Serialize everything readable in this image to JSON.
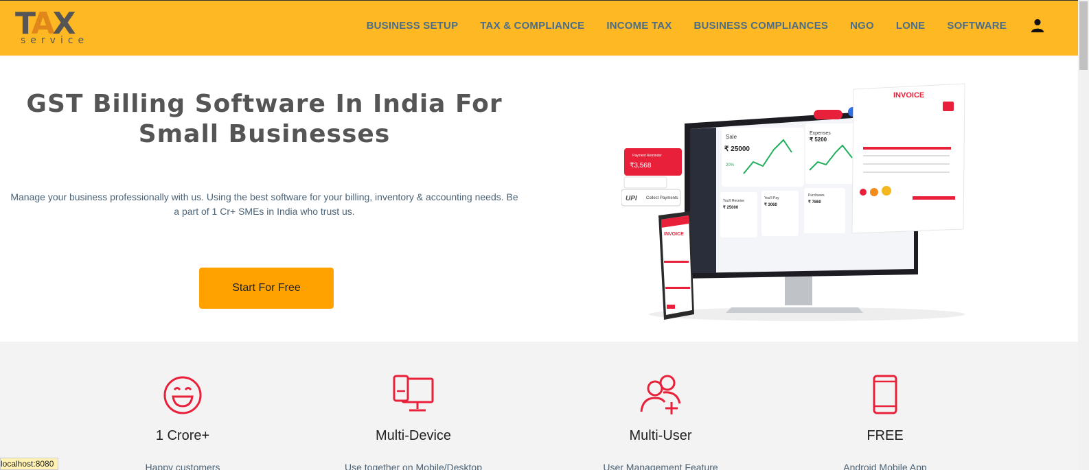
{
  "header": {
    "logo_main": "TAX",
    "logo_sub": "service",
    "nav": [
      "BUSINESS SETUP",
      "TAX & COMPLIANCE",
      "INCOME TAX",
      "BUSINESS COMPLIANCES",
      "NGO",
      "LONE",
      "SOFTWARE"
    ],
    "user_icon": "user-icon"
  },
  "hero": {
    "title": "GST Billing Software In India For Small Businesses",
    "description": "Manage your business professionally with us. Using the best software for your billing, inventory & accounting needs. Be a part of 1 Cr+ SMEs in India who trust us.",
    "cta_label": "Start For Free"
  },
  "illustration": {
    "invoice_title": "INVOICE",
    "phone_invoice_title": "INVOICE",
    "payment_reminder": "Payment Reminder",
    "payment_amount": "₹3,568",
    "collect_payments": "Collect Payments",
    "upi": "UPI",
    "sale_label": "Sale",
    "sale_amount": "₹ 25000",
    "sale_growth": "20%",
    "expenses_label": "Expenses",
    "expenses_amount": "₹ 5200",
    "receive_label": "You'll Receive",
    "receive_amount": "₹ 25000",
    "pay_label": "You'll Pay",
    "pay_amount": "₹ 3060",
    "purchases_label": "Purchases",
    "purchases_amount": "₹ 7860"
  },
  "features": [
    {
      "icon": "smiley-icon",
      "title": "1 Crore+",
      "desc": "Happy customers"
    },
    {
      "icon": "multi-device-icon",
      "title": "Multi-Device",
      "desc": "Use together on Mobile/Desktop"
    },
    {
      "icon": "multi-user-icon",
      "title": "Multi-User",
      "desc": "User Management Feature"
    },
    {
      "icon": "mobile-icon",
      "title": "FREE",
      "desc": "Android Mobile App"
    }
  ],
  "status_bar": {
    "url": "localhost:8080"
  },
  "colors": {
    "header_bg": "#FDB823",
    "cta_bg": "#FFA200",
    "accent_red": "#E8203A",
    "nav_text": "#4a6e8a"
  }
}
